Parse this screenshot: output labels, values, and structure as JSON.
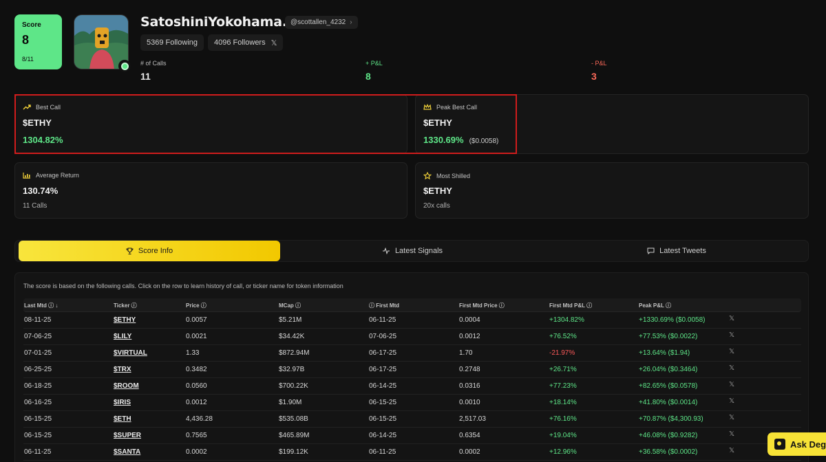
{
  "profile": {
    "score_label": "Score",
    "score_value": "8",
    "score_sub": "8/11",
    "name": "SatoshiniYokohama.eth",
    "handle": "@scottallen_4232",
    "following": "5369 Following",
    "followers": "4096 Followers",
    "stats": [
      {
        "label": "# of Calls",
        "value": "11"
      },
      {
        "label": "+ P&L",
        "value": "8"
      },
      {
        "label": "- P&L",
        "value": "3"
      }
    ]
  },
  "cards": {
    "best_call": {
      "label": "Best Call",
      "ticker": "$ETHY",
      "pct": "1304.82%"
    },
    "peak_best_call": {
      "label": "Peak Best Call",
      "ticker": "$ETHY",
      "pct": "1330.69%",
      "price": "($0.0058)"
    },
    "average_return": {
      "label": "Average Return",
      "value": "130.74%",
      "sub": "11 Calls"
    },
    "most_shilled": {
      "label": "Most Shilled",
      "ticker": "$ETHY",
      "sub": "20x calls"
    }
  },
  "tabs": [
    {
      "label": "Score Info"
    },
    {
      "label": "Latest Signals"
    },
    {
      "label": "Latest Tweets"
    }
  ],
  "table": {
    "note": "The score is based on the following calls. Click on the row to learn history of call, or ticker name for token information",
    "headers": [
      "Last Mtd ⓘ ↓",
      "Ticker ⓘ",
      "Price ⓘ",
      "MCap ⓘ",
      "ⓘ First Mtd",
      "First Mtd Price ⓘ",
      "First Mtd P&L ⓘ",
      "Peak P&L ⓘ"
    ],
    "rows": [
      [
        "08-11-25",
        "$ETHY",
        "0.0057",
        "$5.21M",
        "06-11-25",
        "0.0004",
        "+1304.82%",
        "+1330.69% ($0.0058)"
      ],
      [
        "07-06-25",
        "$LILY",
        "0.0021",
        "$34.42K",
        "07-06-25",
        "0.0012",
        "+76.52%",
        "+77.53% ($0.0022)"
      ],
      [
        "07-01-25",
        "$VIRTUAL",
        "1.33",
        "$872.94M",
        "06-17-25",
        "1.70",
        "-21.97%",
        "+13.64% ($1.94)"
      ],
      [
        "06-25-25",
        "$TRX",
        "0.3482",
        "$32.97B",
        "06-17-25",
        "0.2748",
        "+26.71%",
        "+26.04% ($0.3464)"
      ],
      [
        "06-18-25",
        "$ROOM",
        "0.0560",
        "$700.22K",
        "06-14-25",
        "0.0316",
        "+77.23%",
        "+82.65% ($0.0578)"
      ],
      [
        "06-16-25",
        "$IRIS",
        "0.0012",
        "$1.90M",
        "06-15-25",
        "0.0010",
        "+18.14%",
        "+41.80% ($0.0014)"
      ],
      [
        "06-15-25",
        "$ETH",
        "4,436.28",
        "$535.08B",
        "06-15-25",
        "2,517.03",
        "+76.16%",
        "+70.87% ($4,300.93)"
      ],
      [
        "06-15-25",
        "$SUPER",
        "0.7565",
        "$465.89M",
        "06-14-25",
        "0.6354",
        "+19.04%",
        "+46.08% ($0.9282)"
      ],
      [
        "06-11-25",
        "$SANTA",
        "0.0002",
        "$199.12K",
        "06-11-25",
        "0.0002",
        "+12.96%",
        "+36.58% ($0.0002)"
      ]
    ]
  },
  "ask_button": {
    "label": "Ask Dege"
  },
  "colors": {
    "accent_green": "#5ee688",
    "accent_yellow": "#f7e236",
    "negative_red": "#ff5a5a",
    "highlight_red": "#d11c1c"
  }
}
